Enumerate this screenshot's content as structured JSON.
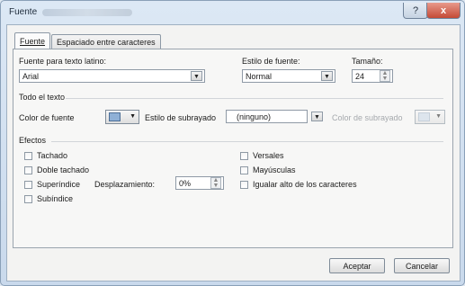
{
  "window": {
    "title": "Fuente",
    "help_glyph": "?",
    "close_glyph": "x"
  },
  "tabs": [
    {
      "label": "Fuente",
      "active": true
    },
    {
      "label": "Espaciado entre caracteres",
      "active": false
    }
  ],
  "font": {
    "family_label": "Fuente para texto latino:",
    "family_value": "Arial",
    "style_label": "Estilo de fuente:",
    "style_value": "Normal",
    "size_label": "Tamaño:",
    "size_value": "24"
  },
  "all_text": {
    "section_label": "Todo el texto",
    "font_color_label": "Color de fuente",
    "underline_style_label": "Estilo de subrayado",
    "underline_style_value": "(ninguno)",
    "underline_color_label": "Color de subrayado"
  },
  "effects": {
    "section_label": "Efectos",
    "left": [
      {
        "label": "Tachado",
        "checked": false
      },
      {
        "label": "Doble tachado",
        "checked": false
      },
      {
        "label": "Superíndice",
        "checked": false
      },
      {
        "label": "Subíndice",
        "checked": false
      }
    ],
    "offset_label": "Desplazamiento:",
    "offset_value": "0%",
    "right": [
      {
        "label": "Versales",
        "checked": false
      },
      {
        "label": "Mayúsculas",
        "checked": false
      },
      {
        "label": "Igualar alto de los caracteres",
        "checked": false
      }
    ]
  },
  "buttons": {
    "accept": "Aceptar",
    "cancel": "Cancelar"
  },
  "glyphs": {
    "dropdown": "▼",
    "spin_up": "▲",
    "spin_down": "▼"
  }
}
